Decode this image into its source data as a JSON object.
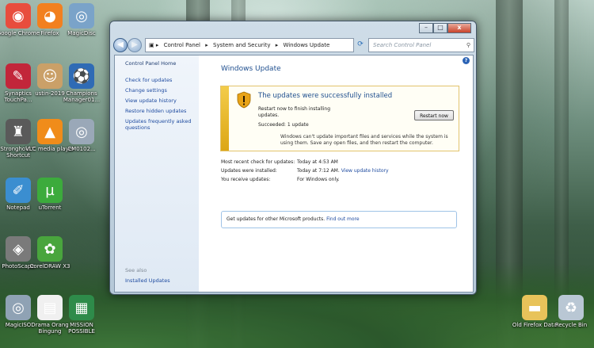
{
  "desktop_icons": [
    {
      "label": "Google Chrome",
      "icon": "chrome-icon",
      "color": "#e84d3d"
    },
    {
      "label": "Firefox",
      "icon": "firefox-icon",
      "color": "#f2801f"
    },
    {
      "label": "MagicDisc",
      "icon": "disc-icon",
      "color": "#7aa3c9"
    },
    {
      "label": "Synaptics TouchPa...",
      "icon": "synaptics-icon",
      "color": "#c2263a"
    },
    {
      "label": "ustin-2019",
      "icon": "user-icon",
      "color": "#caa068"
    },
    {
      "label": "Champions Manager01...",
      "icon": "soccer-icon",
      "color": "#2f6bb5"
    },
    {
      "label": "Stronghold™ Shortcut",
      "icon": "castle-icon",
      "color": "#5a5a5a"
    },
    {
      "label": "VLC media player",
      "icon": "vlc-cone-icon",
      "color": "#f08c1a"
    },
    {
      "label": "CM0102...",
      "icon": "disc-icon",
      "color": "#9aa8b8"
    },
    {
      "label": "Notepad",
      "icon": "notepad-icon",
      "color": "#3b8ed0"
    },
    {
      "label": "uTorrent",
      "icon": "utorrent-icon",
      "color": "#3cab3c"
    },
    {
      "label": "PhotoScape",
      "icon": "photoscape-icon",
      "color": "#7a7a7a"
    },
    {
      "label": "CorelDRAW X3",
      "icon": "coreldraw-icon",
      "color": "#49a53d"
    },
    {
      "label": "MagicISO",
      "icon": "disc-icon",
      "color": "#8fa2b4"
    },
    {
      "label": "Drama Orang Bingung",
      "icon": "document-icon",
      "color": "#f0f0f0"
    },
    {
      "label": "MISSION POSSIBLE",
      "icon": "excel-icon",
      "color": "#2e8b4a"
    },
    {
      "label": "Old Firefox Data",
      "icon": "folder-icon",
      "color": "#e8c35a"
    },
    {
      "label": "Recycle Bin",
      "icon": "recycle-bin-icon",
      "color": "#b9c7d4"
    }
  ],
  "window": {
    "controls": {
      "minimize": "–",
      "maximize": "□",
      "close": "x"
    },
    "nav": {
      "back": "◀",
      "forward": "▶"
    },
    "breadcrumb": [
      "Control Panel",
      "System and Security",
      "Windows Update"
    ],
    "search_placeholder": "Search Control Panel",
    "sidebar": {
      "home": "Control Panel Home",
      "links": [
        "Check for updates",
        "Change settings",
        "View update history",
        "Restore hidden updates",
        "Updates frequently asked questions"
      ],
      "see_also": "See also",
      "installed_updates": "Installed Updates"
    },
    "main": {
      "title": "Windows Update",
      "alert": {
        "heading": "The updates were successfully installed",
        "restart_text": "Restart now to finish installing updates.",
        "succeeded": "Succeeded: 1 update",
        "warning": "Windows can't update important files and services while the system is using them. Save any open files, and then restart the computer.",
        "button": "Restart now"
      },
      "info": [
        {
          "key": "Most recent check for updates:",
          "value": "Today at 4:53 AM",
          "link": ""
        },
        {
          "key": "Updates were installed:",
          "value": "Today at 7:12 AM.",
          "link": "View update history"
        },
        {
          "key": "You receive updates:",
          "value": "For Windows only.",
          "link": ""
        }
      ],
      "get_updates": {
        "text": "Get updates for other Microsoft products.",
        "link": "Find out more"
      }
    }
  }
}
